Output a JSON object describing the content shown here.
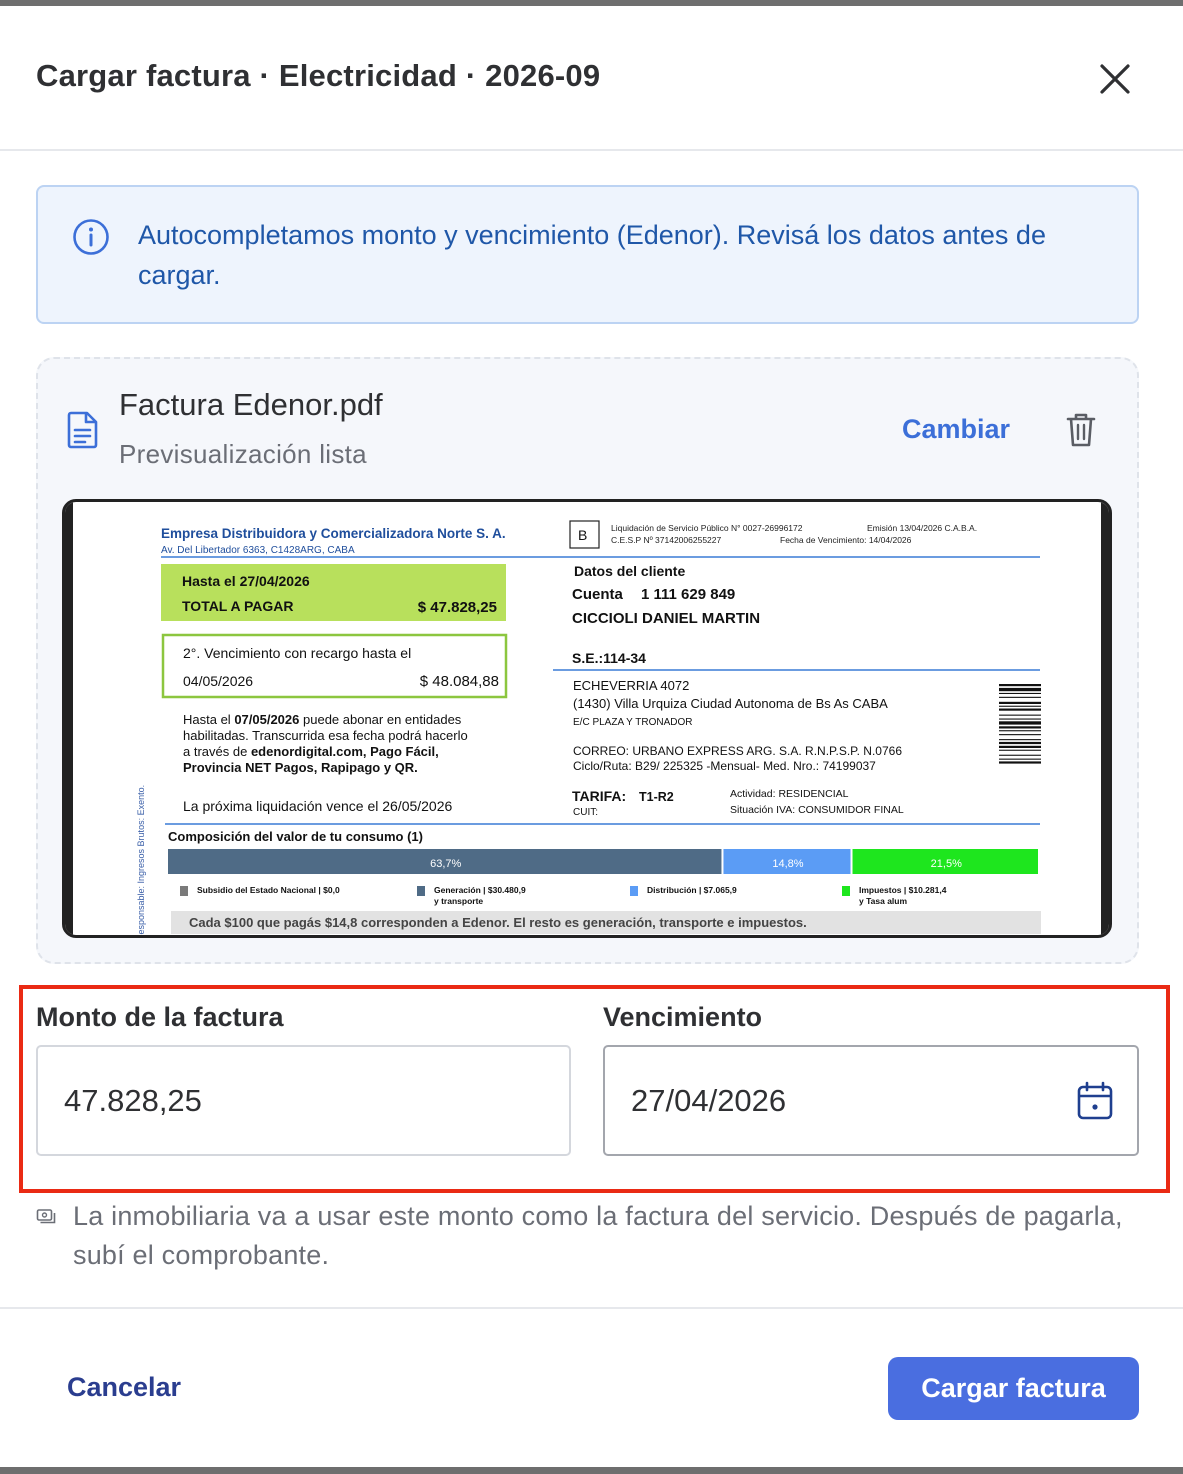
{
  "dialog": {
    "title": "Cargar factura · Electricidad · 2026-09",
    "close_icon": "close-icon"
  },
  "banner": {
    "text": "Autocompletamos monto y vencimiento (Edenor). Revisá los datos antes de cargar.",
    "icon": "info-icon",
    "color": "#1f57a8"
  },
  "file": {
    "name": "Factura Edenor.pdf",
    "status": "Previsualización lista",
    "change_label": "Cambiar",
    "icon": "document-icon",
    "delete_icon": "trash-icon"
  },
  "invoice": {
    "company": "Empresa Distribuidora y Comercializadora Norte S. A.",
    "address": "Av. Del Libertador 6363, C1428ARG, CABA",
    "type_letter": "B",
    "header_line1": "Liquidación de Servicio Público N° 0027-26996172",
    "header_line2": "C.E.S.P Nº 37142006255227",
    "emission": "Emisión  13/04/2026   C.A.B.A.",
    "due_header": "Fecha de Vencimiento: 14/04/2026",
    "due_until": "Hasta el 27/04/2026",
    "total_label": "TOTAL A PAGAR",
    "total_value": "$ 47.828,25",
    "second_due": "2°. Vencimiento con recargo hasta el",
    "second_due_date": "04/05/2026",
    "second_due_value": "$ 48.084,88",
    "pay_p1": "Hasta el ",
    "pay_date": "07/05/2026",
    "pay_p2": " puede abonar en entidades",
    "pay_line2": "habilitadas. Transcurrida esa fecha podrá hacerlo",
    "pay_p3": "a través de ",
    "pay_channels": "edenordigital.com, Pago Fácil,",
    "pay_line4": "Provincia NET Pagos, Rapipago y QR.",
    "next": "La próxima liquidación vence el 26/05/2026",
    "side_text": "Responsable: Ingresos Brutos: Exento.",
    "client_title": "Datos del cliente",
    "account_label": "Cuenta",
    "account_value": "1 111 629 849",
    "client_name": "CICCIOLI DANIEL MARTIN",
    "se": "S.E.:114-34",
    "addr1": "ECHEVERRIA 4072",
    "addr2": "(1430) Villa Urquiza Ciudad Autonoma de Bs As CABA",
    "addr3": "E/C PLAZA Y TRONADOR",
    "mail1": "CORREO: URBANO EXPRESS ARG. S.A. R.N.P.S.P. N.0766",
    "mail2": "Ciclo/Ruta:  B29/ 225325 -Mensual- Med. Nro.: 74199037",
    "tariff_label": "TARIFA:",
    "tariff_value": "T1-R2",
    "cuit": "CUIT:",
    "activity": "Actividad: RESIDENCIAL",
    "iva": "Situación IVA: CONSUMIDOR FINAL",
    "composition_title": "Composición del valor de tu consumo (1)",
    "bar_values": [
      {
        "label": "63,7%",
        "value": 63.7,
        "color": "#4f6b86"
      },
      {
        "label": "14,8%",
        "value": 14.8,
        "color": "#5b9cf5"
      },
      {
        "label": "21,5%",
        "value": 21.5,
        "color": "#1ee61e"
      }
    ],
    "legend": [
      {
        "label": "Subsidio del Estado Nacional | $0,0",
        "color": "#7a7a7a"
      },
      {
        "label": "Generación | $30.480,9\ny transporte",
        "color": "#4f6b86"
      },
      {
        "label": "Distribución | $7.065,9",
        "color": "#5b9cf5"
      },
      {
        "label": "Impuestos | $10.281,4\ny Tasa alum",
        "color": "#1ee61e"
      }
    ],
    "footer_note": "Cada $100 que pagás $14,8 corresponden a Edenor. El resto es generación, transporte e impuestos.",
    "accent_green": "#b8e05c",
    "accent_blue": "#5b8fe0"
  },
  "fields": {
    "amount_label": "Monto de la factura",
    "amount_value": "47.828,25",
    "due_label": "Vencimiento",
    "due_value": "27/04/2026",
    "calendar_icon": "calendar-icon"
  },
  "note": {
    "icon": "money-icon",
    "text": "La inmobiliaria va a usar este monto como la factura del servicio. Después de pagarla, subí el comprobante."
  },
  "footer": {
    "cancel_label": "Cancelar",
    "submit_label": "Cargar factura",
    "primary_color": "#4a6ee0"
  }
}
